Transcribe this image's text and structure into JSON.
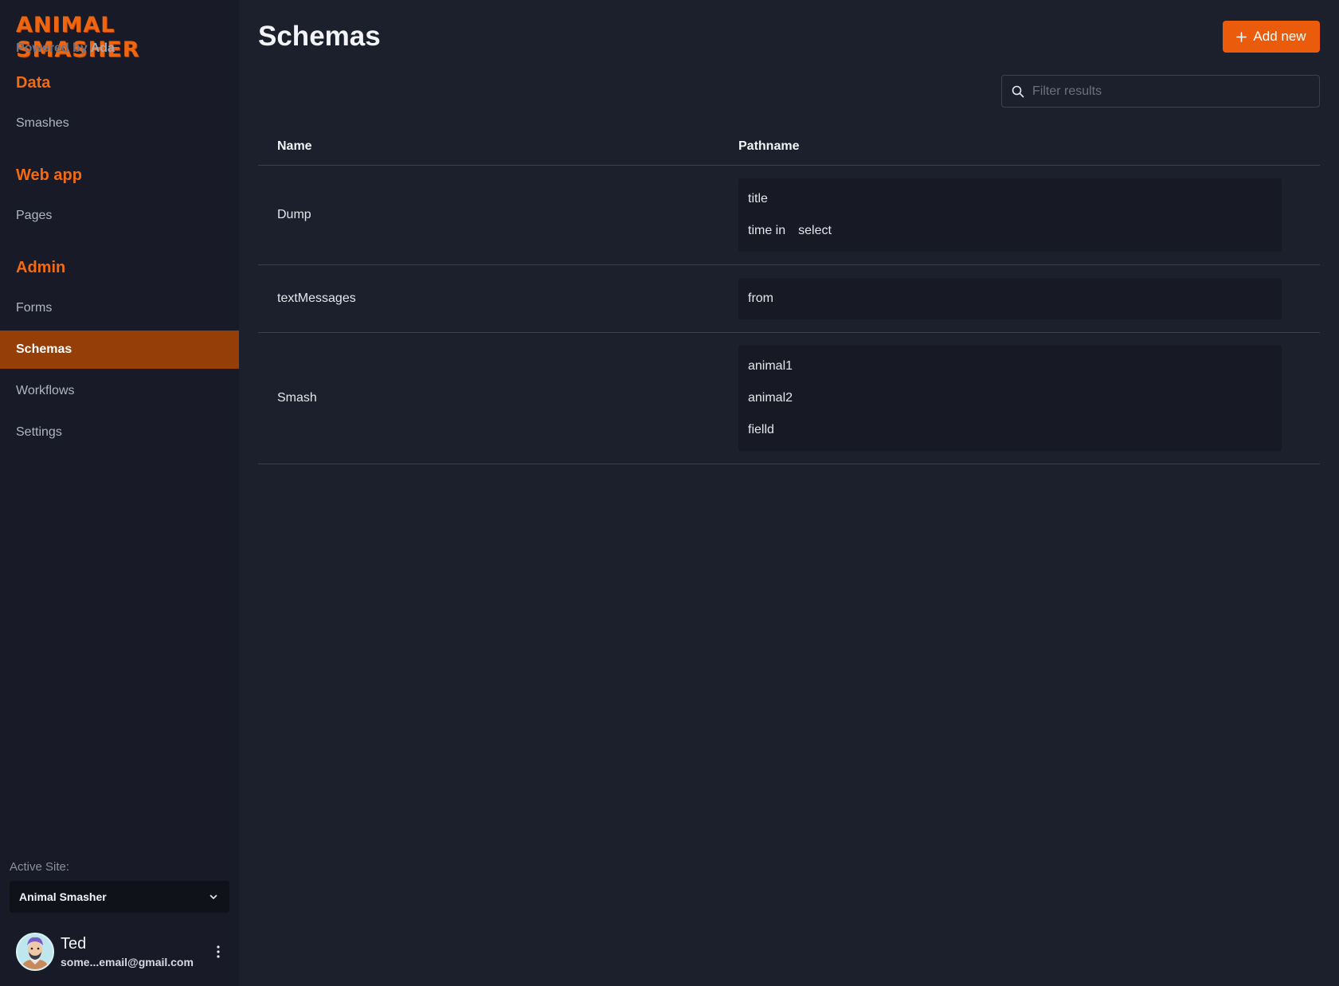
{
  "sidebar": {
    "brand": "ANIMAL SMASHER",
    "powered_by": "Powered by",
    "powered_name": "Ada",
    "sections": [
      {
        "heading": "Data",
        "items": [
          "Smashes"
        ]
      },
      {
        "heading": "Web app",
        "items": [
          "Pages"
        ]
      },
      {
        "heading": "Admin",
        "items": [
          "Forms",
          "Schemas",
          "Workflows",
          "Settings"
        ]
      }
    ],
    "active_item": "Schemas",
    "active_site_label": "Active Site:",
    "active_site_value": "Animal Smasher",
    "user": {
      "name": "Ted",
      "email": "some...email@gmail.com"
    }
  },
  "main": {
    "title": "Schemas",
    "add_button": "Add new",
    "filter_placeholder": "Filter results",
    "table": {
      "headers": [
        "Name",
        "Pathname"
      ],
      "rows": [
        {
          "name": "Dump",
          "paths": [
            [
              "title"
            ],
            [
              "time in",
              "select"
            ]
          ]
        },
        {
          "name": "textMessages",
          "paths": [
            [
              "from"
            ]
          ]
        },
        {
          "name": "Smash",
          "paths": [
            [
              "animal1"
            ],
            [
              "animal2"
            ],
            [
              "fielld"
            ]
          ]
        }
      ]
    }
  },
  "colors": {
    "accent": "#ea5b0c",
    "active_nav": "#953e08",
    "heading": "#f26a12",
    "background": "#1c1f2c",
    "sidebar": "#181b27"
  }
}
